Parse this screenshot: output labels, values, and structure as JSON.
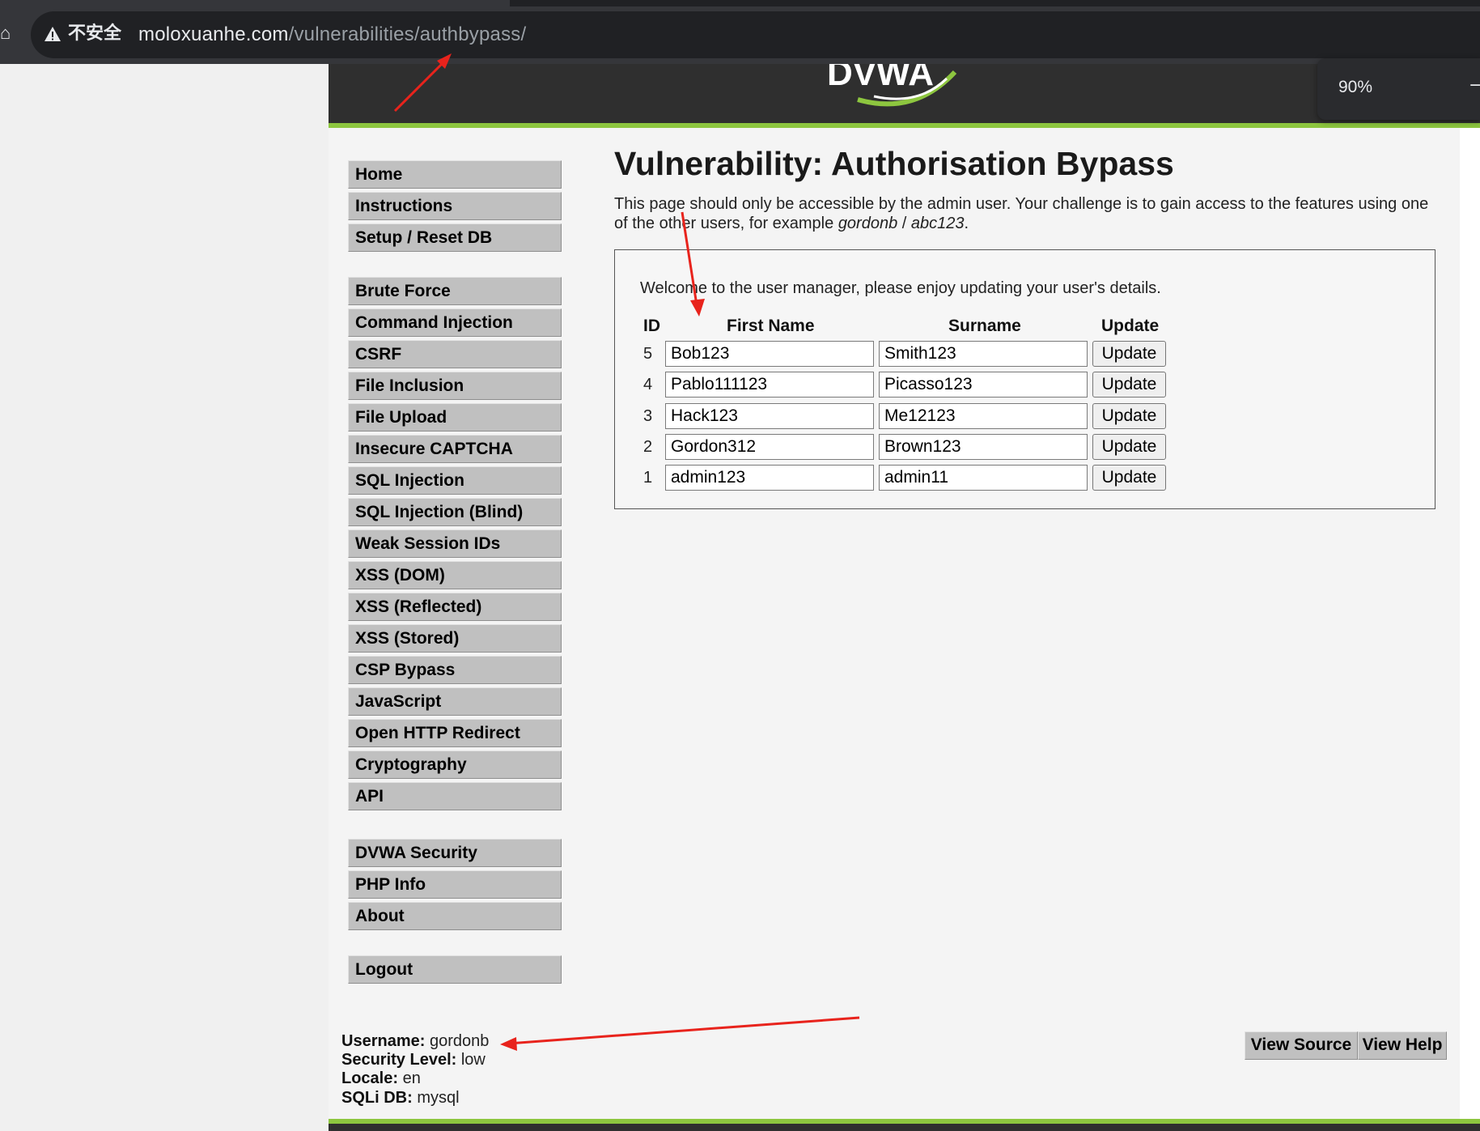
{
  "browser": {
    "security_label": "不安全",
    "url_host": "moloxuanhe.com",
    "url_path": "/vulnerabilities/authbypass/",
    "zoom": "90%"
  },
  "logo_text": "DVWA",
  "menu": {
    "group1": [
      "Home",
      "Instructions",
      "Setup / Reset DB"
    ],
    "group2": [
      "Brute Force",
      "Command Injection",
      "CSRF",
      "File Inclusion",
      "File Upload",
      "Insecure CAPTCHA",
      "SQL Injection",
      "SQL Injection (Blind)",
      "Weak Session IDs",
      "XSS (DOM)",
      "XSS (Reflected)",
      "XSS (Stored)",
      "CSP Bypass",
      "JavaScript",
      "Open HTTP Redirect",
      "Cryptography",
      "API"
    ],
    "group3": [
      "DVWA Security",
      "PHP Info",
      "About"
    ],
    "group4": [
      "Logout"
    ]
  },
  "main": {
    "title": "Vulnerability: Authorisation Bypass",
    "intro_part1": "This page should only be accessible by the admin user. Your challenge is to gain access to the features using one of the other users, for example ",
    "intro_user": "gordonb",
    "intro_sep": " / ",
    "intro_pass": "abc123",
    "intro_end": ".",
    "welcome": "Welcome to the user manager, please enjoy updating your user's details.",
    "table": {
      "headers": [
        "ID",
        "First Name",
        "Surname",
        "Update"
      ],
      "rows": [
        {
          "id": "5",
          "first": "Bob123",
          "last": "Smith123",
          "action": "Update"
        },
        {
          "id": "4",
          "first": "Pablo111123",
          "last": "Picasso123",
          "action": "Update"
        },
        {
          "id": "3",
          "first": "Hack123",
          "last": "Me12123",
          "action": "Update"
        },
        {
          "id": "2",
          "first": "Gordon312",
          "last": "Brown123",
          "action": "Update"
        },
        {
          "id": "1",
          "first": "admin123",
          "last": "admin11",
          "action": "Update"
        }
      ]
    }
  },
  "footer": {
    "username_label": "Username:",
    "username": "gordonb",
    "security_label": "Security Level:",
    "security": "low",
    "locale_label": "Locale:",
    "locale": "en",
    "sqli_label": "SQLi DB:",
    "sqli": "mysql",
    "view_source": "View Source",
    "view_help": "View Help"
  },
  "colors": {
    "accent_green": "#8dc63f",
    "header_dark": "#2f2f2f",
    "annotation_red": "#e8231c"
  }
}
